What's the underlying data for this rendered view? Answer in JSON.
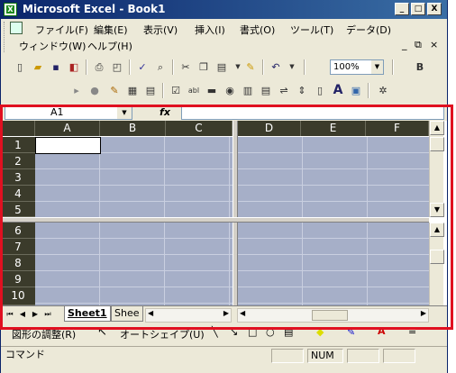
{
  "window": {
    "title": "Microsoft Excel - Book1",
    "icon": "excel-icon",
    "buttons": [
      "_",
      "□",
      "X"
    ]
  },
  "menu": {
    "row1": [
      "ファイル(F)",
      "編集(E)",
      "表示(V)",
      "挿入(I)",
      "書式(O)",
      "ツール(T)",
      "データ(D)"
    ],
    "row2": [
      "ウィンドウ(W)",
      "ヘルプ(H)"
    ],
    "doc_controls": [
      "_",
      "⧉",
      "×"
    ]
  },
  "toolbar": {
    "zoom": "100%",
    "bold": "B"
  },
  "formula_bar": {
    "name_box": "A1",
    "fx": "fx",
    "value": ""
  },
  "columns": [
    "A",
    "B",
    "C",
    "D",
    "E",
    "F"
  ],
  "rows_top": [
    "1",
    "2",
    "3",
    "4",
    "5"
  ],
  "rows_bottom": [
    "6",
    "7",
    "8",
    "9",
    "10"
  ],
  "sheets": {
    "tabs": [
      "Sheet1",
      "Shee"
    ],
    "active": "Sheet1"
  },
  "drawing": {
    "draw_menu": "図形の調整(R)",
    "autoshape": "オートシェイプ(U)"
  },
  "status": {
    "mode": "コマンド",
    "num": "NUM"
  },
  "colors": {
    "title_start": "#0a246a",
    "title_end": "#3a6ea5",
    "cell_fill": "#a6afc8",
    "header": "#3b3b2b",
    "highlight": "#e01020"
  }
}
